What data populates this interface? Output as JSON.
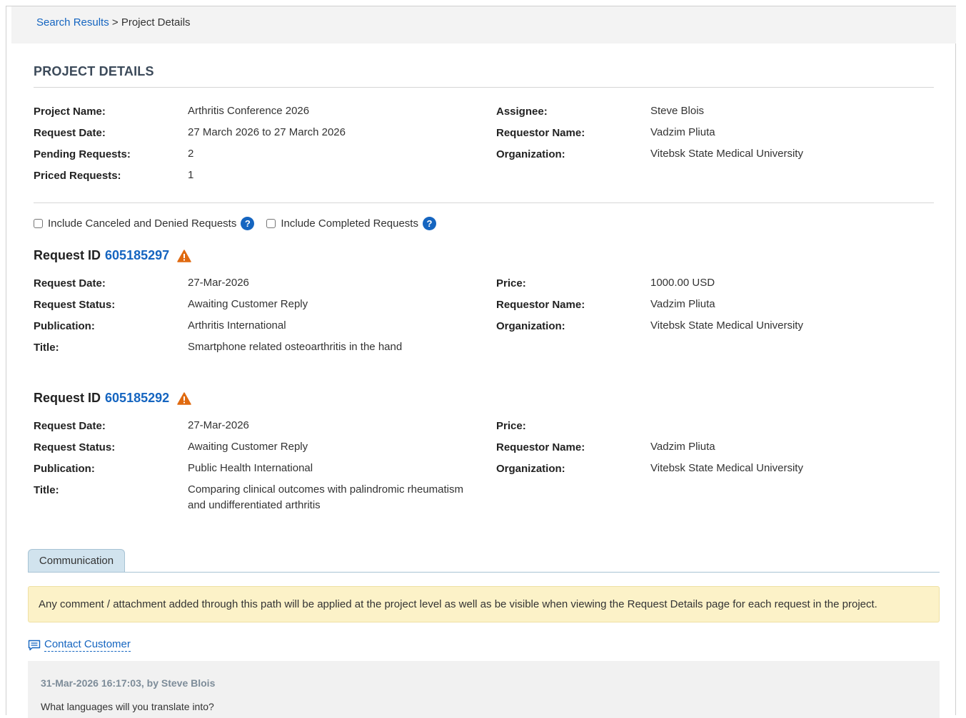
{
  "breadcrumb": {
    "link": "Search Results",
    "separator": ">",
    "current": "Project Details"
  },
  "heading": "PROJECT DETAILS",
  "project": {
    "left": [
      {
        "label": "Project Name:",
        "value": "Arthritis Conference 2026"
      },
      {
        "label": "Request Date:",
        "value": "27 March 2026 to 27 March 2026"
      },
      {
        "label": "Pending Requests:",
        "value": "2"
      },
      {
        "label": "Priced Requests:",
        "value": "1"
      }
    ],
    "right": [
      {
        "label": "Assignee:",
        "value": "Steve Blois"
      },
      {
        "label": "Requestor Name:",
        "value": "Vadzim Pliuta"
      },
      {
        "label": "Organization:",
        "value": "Vitebsk State Medical University"
      }
    ]
  },
  "filters": {
    "canceled_label": "Include Canceled and Denied Requests",
    "completed_label": "Include Completed Requests",
    "help_glyph": "?"
  },
  "requests": [
    {
      "prefix": "Request ID",
      "id": "605185297",
      "left": [
        {
          "label": "Request Date:",
          "value": "27-Mar-2026"
        },
        {
          "label": "Request Status:",
          "value": "Awaiting Customer Reply"
        },
        {
          "label": "Publication:",
          "value": "Arthritis International"
        },
        {
          "label": "Title:",
          "value": "Smartphone related osteoarthritis in the hand"
        }
      ],
      "right": [
        {
          "label": "Price:",
          "value": "1000.00 USD"
        },
        {
          "label": "Requestor Name:",
          "value": "Vadzim Pliuta"
        },
        {
          "label": "Organization:",
          "value": "Vitebsk State Medical University"
        }
      ]
    },
    {
      "prefix": "Request ID",
      "id": "605185292",
      "left": [
        {
          "label": "Request Date:",
          "value": "27-Mar-2026"
        },
        {
          "label": "Request Status:",
          "value": "Awaiting Customer Reply"
        },
        {
          "label": "Publication:",
          "value": "Public Health International"
        },
        {
          "label": "Title:",
          "value": "Comparing clinical outcomes with palindromic rheumatism and undifferentiated arthritis"
        }
      ],
      "right": [
        {
          "label": "Price:",
          "value": ""
        },
        {
          "label": "Requestor Name:",
          "value": "Vadzim Pliuta"
        },
        {
          "label": "Organization:",
          "value": "Vitebsk State Medical University"
        }
      ]
    }
  ],
  "communication": {
    "tab_label": "Communication",
    "notice": "Any comment / attachment added through this path will be applied at the project level as well as be visible when viewing the Request Details page for each request in the project.",
    "contact_label": "Contact Customer",
    "comment": {
      "meta": "31-Mar-2026 16:17:03, by Steve Blois",
      "text": "What languages will you translate into?"
    }
  },
  "colors": {
    "link": "#1565c0",
    "warning": "#e06a10",
    "notice_bg": "#fcf2c8",
    "tab_bg": "#d1e3ee"
  },
  "icons": {
    "warning": "warning-icon",
    "help": "help-icon",
    "comment": "comment-icon"
  }
}
